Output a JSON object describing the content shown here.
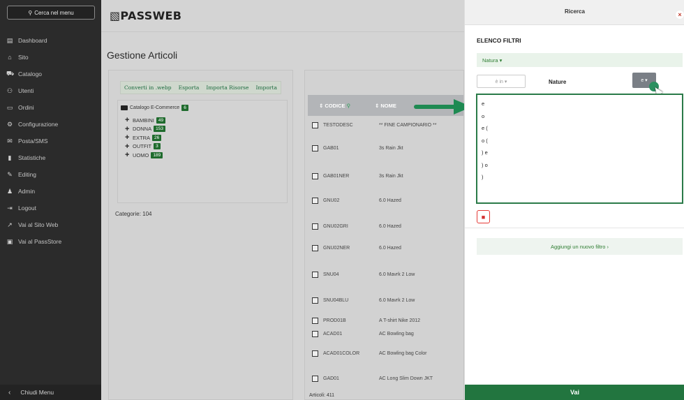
{
  "sidebar": {
    "search_label": "Cerca nel menu",
    "items": [
      {
        "label": "Dashboard",
        "icon": "▤"
      },
      {
        "label": "Sito",
        "icon": "⌂"
      },
      {
        "label": "Catalogo",
        "icon": "⛟"
      },
      {
        "label": "Utenti",
        "icon": "⚇"
      },
      {
        "label": "Ordini",
        "icon": "▭"
      },
      {
        "label": "Configurazione",
        "icon": "⚙"
      },
      {
        "label": "Posta/SMS",
        "icon": "✉"
      },
      {
        "label": "Statistiche",
        "icon": "▮"
      },
      {
        "label": "Editing",
        "icon": "✎"
      },
      {
        "label": "Admin",
        "icon": "♟"
      },
      {
        "label": "Logout",
        "icon": "⇥"
      },
      {
        "label": "Vai al Sito Web",
        "icon": "↗"
      },
      {
        "label": "Vai al PassStore",
        "icon": "▣"
      }
    ],
    "close_label": "Chiudi Menu"
  },
  "header": {
    "logo": "▧PASSWEB"
  },
  "main": {
    "title": "Gestione Articoli",
    "tools": [
      "Converti in .webp",
      "Esporta",
      "Importa Risorse",
      "Importa"
    ],
    "tree": {
      "root_label": "Catalogo E-Commerce",
      "root_count": "6",
      "items": [
        {
          "label": "BAMBINI",
          "count": "49"
        },
        {
          "label": "DONNA",
          "count": "153"
        },
        {
          "label": "EXTRA",
          "count": "26"
        },
        {
          "label": "OUTFIT",
          "count": "3"
        },
        {
          "label": "UOMO",
          "count": "189"
        }
      ]
    },
    "categories_label": "Categorie: 104"
  },
  "table": {
    "col_code": "CODICE",
    "col_name": "NOME",
    "rows": [
      {
        "code": "TESTODESC",
        "name": "** FINE CAMPIONARIO **"
      },
      {
        "code": "GAB01",
        "name": "3s Rain Jkt"
      },
      {
        "code": "GAB01NER",
        "name": "3s Rain Jkt"
      },
      {
        "code": "GNU02",
        "name": "6.0 Hazed"
      },
      {
        "code": "GNU02GRI",
        "name": "6.0 Hazed"
      },
      {
        "code": "GNU02NER",
        "name": "6.0 Hazed"
      },
      {
        "code": "SNU04",
        "name": "6.0 Mavrk 2 Low"
      },
      {
        "code": "SNU04BLU",
        "name": "6.0 Mavrk 2 Low"
      },
      {
        "code": "PROD01B",
        "name": "A T-shirt Nike 2012"
      },
      {
        "code": "ACAD01",
        "name": "AC Bowling bag"
      },
      {
        "code": "ACAD01COLOR",
        "name": "AC Bowling bag Color"
      },
      {
        "code": "GAD01",
        "name": "AC Long Slim Down JKT"
      }
    ],
    "footer": "Articoli: 411"
  },
  "search_panel": {
    "title": "Ricerca",
    "close": "×",
    "filters_title": "ELENCO FILTRI",
    "natura_label": "Natura ▾",
    "operator_select": "è in ▾",
    "nature_label": "Nature",
    "conjunction_button": "e ▾",
    "dropdown_options": [
      "e",
      "o",
      "e (",
      "o (",
      ") e",
      ") o",
      ")"
    ],
    "add_filter": "Aggiungi un nuovo filtro ›",
    "go_button": "Vai"
  },
  "colors": {
    "sidebar_bg": "#2b2b2b",
    "accent_green": "#22753f",
    "badge_green": "#1f6b2d",
    "delete_red": "#e53935"
  }
}
